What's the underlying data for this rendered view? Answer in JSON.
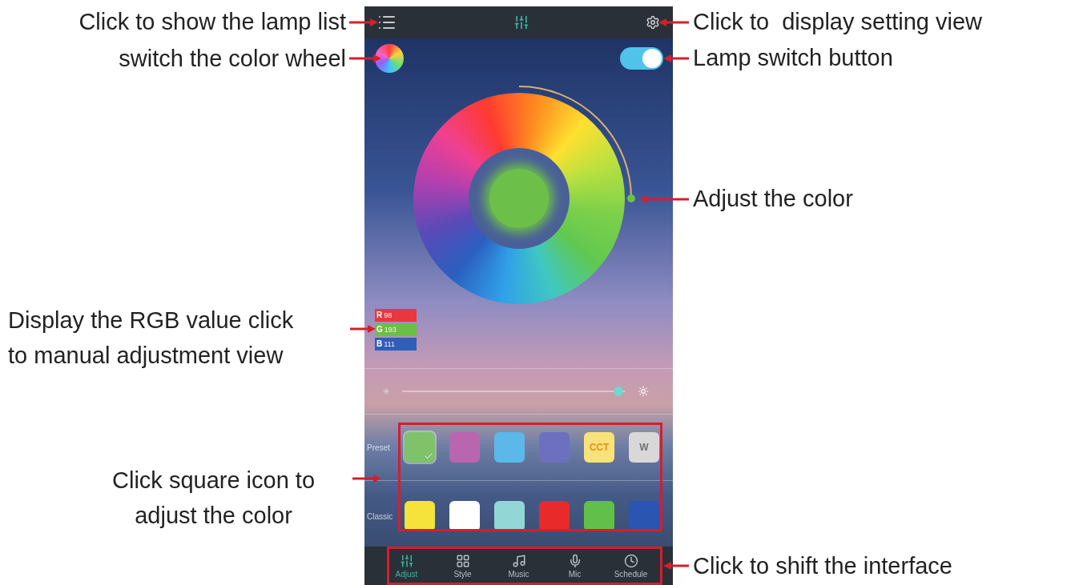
{
  "lamp_switch": {
    "on": true
  },
  "rgb": [
    {
      "label": "R",
      "value": "98",
      "color": "#e8383d"
    },
    {
      "label": "G",
      "value": "193",
      "color": "#6cbf45"
    },
    {
      "label": "B",
      "value": "111",
      "color": "#2f5fb8"
    }
  ],
  "brightness": {
    "level": 0.97
  },
  "preset": {
    "label": "Preset",
    "swatches": [
      {
        "color": "#7fc26a",
        "selected": true
      },
      {
        "color": "#b866b0",
        "selected": false
      },
      {
        "color": "#5bb8e8",
        "selected": false
      },
      {
        "color": "#6d70bf",
        "selected": false
      },
      {
        "color": "#f7e37a",
        "text": "CCT",
        "selected": false
      },
      {
        "color": "#d8d8d8",
        "text": "W",
        "selected": false
      }
    ]
  },
  "classic": {
    "label": "Classic",
    "swatches": [
      {
        "color": "#f5e23a",
        "selected": false
      },
      {
        "color": "#ffffff",
        "selected": false
      },
      {
        "color": "#92d7d6",
        "selected": false
      },
      {
        "color": "#e82a2a",
        "selected": false
      },
      {
        "color": "#62c04a",
        "selected": false
      },
      {
        "color": "#2a55b0",
        "selected": false
      }
    ]
  },
  "nav": [
    {
      "label": "Adjust",
      "selected": true
    },
    {
      "label": "Style",
      "selected": false
    },
    {
      "label": "Music",
      "selected": false
    },
    {
      "label": "Mic",
      "selected": false
    },
    {
      "label": "Schedule",
      "selected": false
    }
  ],
  "annotations": [
    {
      "text": "Click to show the lamp list"
    },
    {
      "text": "switch the color wheel"
    },
    {
      "text": "Click to  display setting view"
    },
    {
      "text": "Lamp switch button"
    },
    {
      "text": "Adjust the color"
    },
    {
      "text": "Display the RGB value click\nto manual adjustment view"
    },
    {
      "text": "Click square icon to\nadjust the color"
    },
    {
      "text": "Click to shift the interface"
    }
  ]
}
